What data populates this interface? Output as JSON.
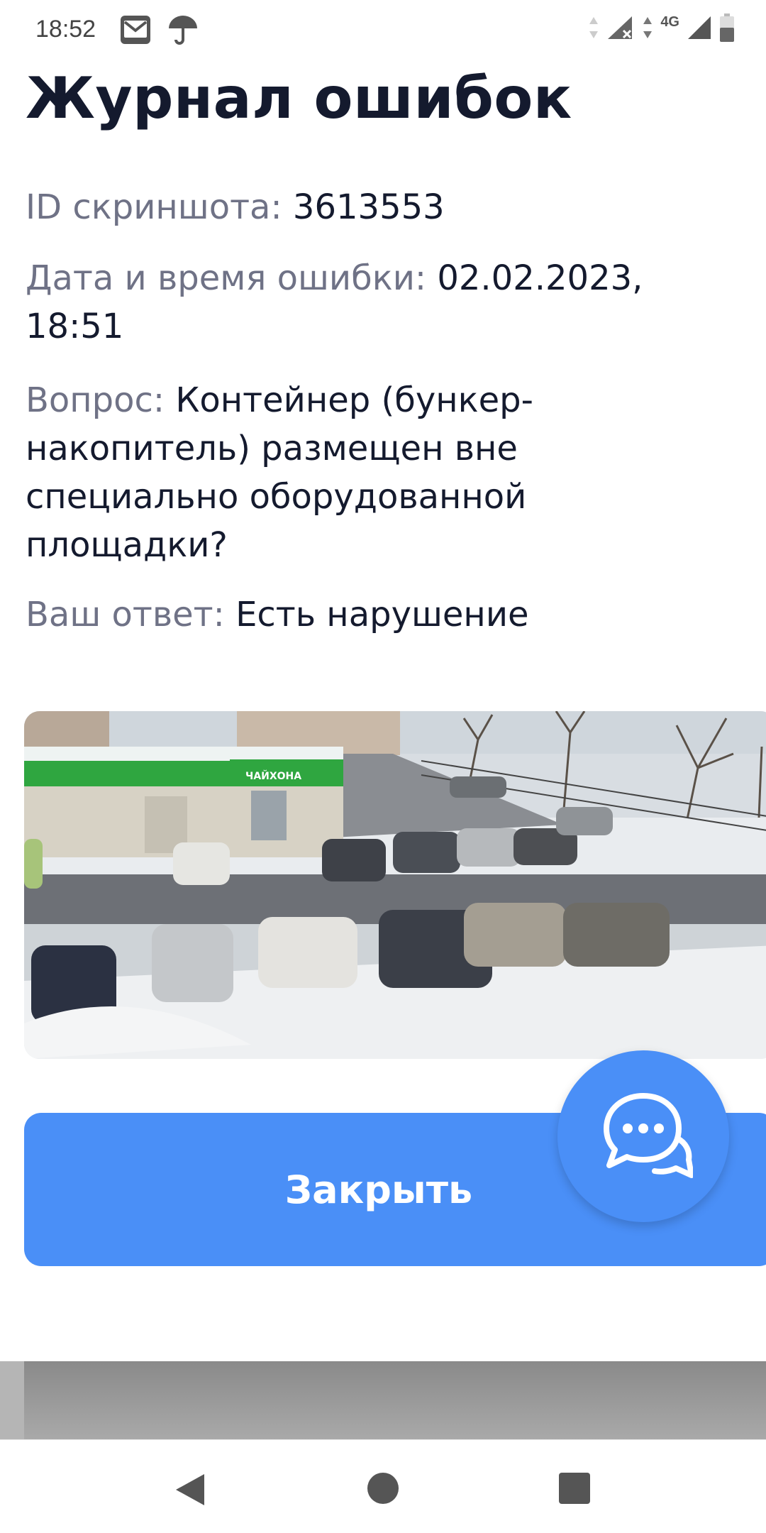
{
  "status_bar": {
    "time": "18:52",
    "network_label": "4G",
    "icons": [
      "mail-icon",
      "umbrella-icon",
      "data-arrows-icon",
      "signal-no-data-icon",
      "signal-icon",
      "battery-icon"
    ]
  },
  "page": {
    "title": "Журнал ошибок"
  },
  "details": {
    "id_label": "ID скриншота:",
    "id_value": "3613553",
    "date_label": "Дата и время ошибки:",
    "date_value": "02.02.2023, 18:51",
    "question_label": "Вопрос:",
    "question_value": "Контейнер (бункер-накопитель) размещен вне специально оборудованной площадки?",
    "answer_label": "Ваш ответ:",
    "answer_value": "Есть нарушение"
  },
  "photo": {
    "shop_sign": "ЧАЙХОНА",
    "description_icon": "camera-snapshot"
  },
  "actions": {
    "close_label": "Закрыть",
    "chat_icon": "chat-bubbles-icon"
  },
  "nav": {
    "icons": [
      "back-icon",
      "home-icon",
      "recents-icon"
    ]
  },
  "colors": {
    "accent": "#4a8ff7",
    "title": "#141a2e",
    "label": "#6f7286"
  }
}
